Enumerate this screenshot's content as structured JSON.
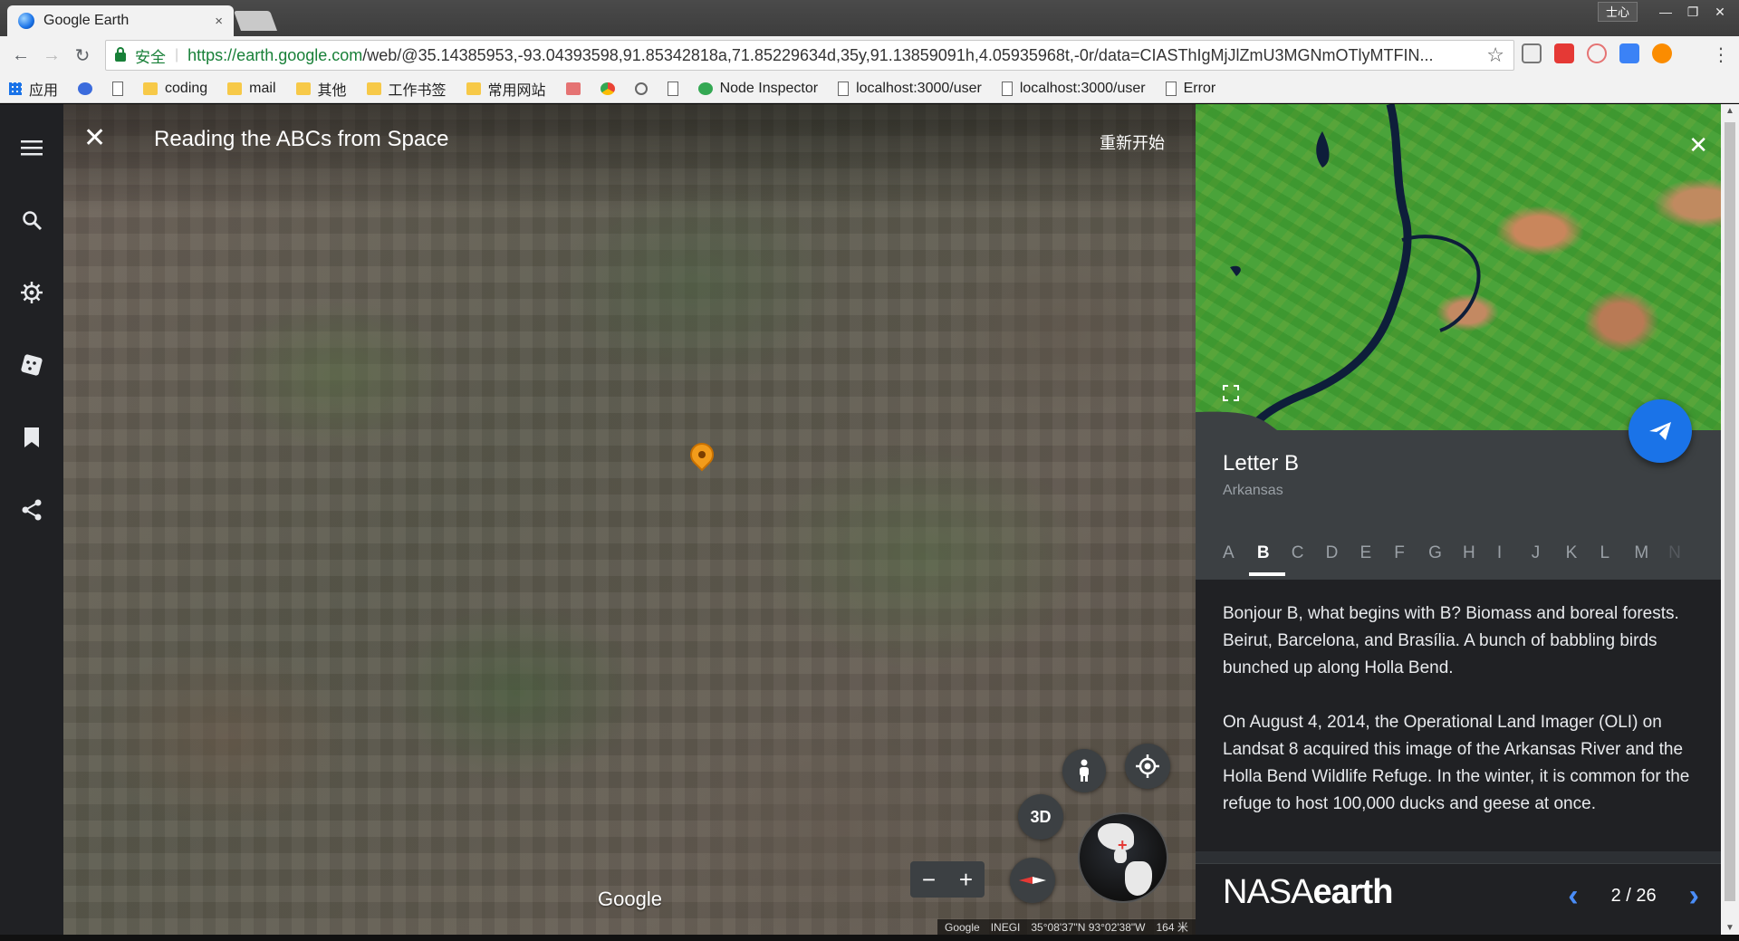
{
  "browser": {
    "tab_title": "Google Earth",
    "tab_close": "×",
    "user_label": "士心",
    "window_min": "—",
    "window_max": "❐",
    "window_close": "✕",
    "back": "←",
    "forward": "→",
    "reload": "↻",
    "secure_label": "安全",
    "url_host": "https://earth.google.com",
    "url_rest": "/web/@35.14385953,-93.04393598,91.85342818a,71.85229634d,35y,91.13859091h,4.05935968t,-0r/data=CIASThIgMjJlZmU3MGNmOTlyMTFIN...",
    "star": "☆",
    "menu": "⋮"
  },
  "bookmarks": [
    {
      "label": "应用",
      "icon": "apps-grid-icon"
    },
    {
      "label": "",
      "icon": "baidu-paw-icon"
    },
    {
      "label": "",
      "icon": "page-icon"
    },
    {
      "label": "coding",
      "icon": "folder-icon"
    },
    {
      "label": "mail",
      "icon": "folder-icon"
    },
    {
      "label": "其他",
      "icon": "folder-icon"
    },
    {
      "label": "工作书签",
      "icon": "folder-icon"
    },
    {
      "label": "常用网站",
      "icon": "folder-icon"
    },
    {
      "label": "",
      "icon": "red-app-icon"
    },
    {
      "label": "",
      "icon": "chrome-icon"
    },
    {
      "label": "",
      "icon": "history-icon"
    },
    {
      "label": "",
      "icon": "page-icon"
    },
    {
      "label": "Node Inspector",
      "icon": "node-inspector-icon"
    },
    {
      "label": "localhost:3000/user",
      "icon": "page-icon"
    },
    {
      "label": "localhost:3000/user",
      "icon": "page-icon"
    },
    {
      "label": "Error",
      "icon": "page-icon"
    }
  ],
  "rail": {
    "menu": "≡",
    "search": "⚲",
    "voyager": "⎈",
    "feeling_lucky": "⚄",
    "projects": "❚",
    "share": "<"
  },
  "map": {
    "close": "✕",
    "title": "Reading the ABCs from Space",
    "restart": "重新开始",
    "google_logo": "Google",
    "view_3d": "3D",
    "zoom_out": "−",
    "zoom_in": "+",
    "attribution": [
      "Google",
      "INEGI",
      "35°08'37\"N 93°02'38\"W",
      "164 米"
    ]
  },
  "panel": {
    "close": "✕",
    "letter_title": "Letter B",
    "location": "Arkansas",
    "alphabet": [
      "A",
      "B",
      "C",
      "D",
      "E",
      "F",
      "G",
      "H",
      "I",
      "J",
      "K",
      "L",
      "M",
      "N"
    ],
    "active_letter": "B",
    "para1": "Bonjour B, what begins with B? Biomass and boreal forests. Beirut, Barcelona, and Brasília. A bunch of babbling birds bunched up along Holla Bend.",
    "para2": "On August 4, 2014, the Operational Land Imager (OLI) on Landsat 8 acquired this image of the Arkansas River and the Holla Bend Wildlife Refuge. In the winter, it is common for the refuge to host 100,000 ducks and geese at once.",
    "brand_light": "NASA",
    "brand_bold": "earth",
    "prev": "‹",
    "next": "›",
    "page_indicator": "2 / 26"
  },
  "colors": {
    "accent": "#1a73e8",
    "pin": "#f29c1b",
    "panel_bg": "#2d3034",
    "rail_bg": "#202124"
  }
}
